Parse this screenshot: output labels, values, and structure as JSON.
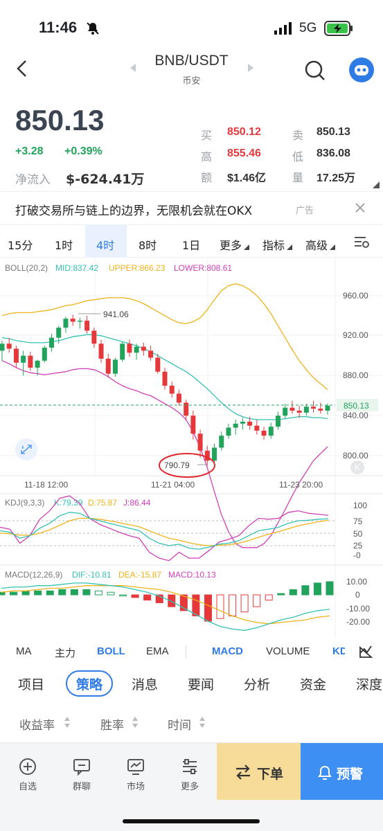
{
  "status": {
    "time": "11:46",
    "network": "5G"
  },
  "header": {
    "pair": "BNB/USDT",
    "exchange": "币安"
  },
  "price": {
    "last": "850.13",
    "change": "+3.28",
    "change_pct": "+0.39%",
    "net_inflow_label": "净流入",
    "net_inflow": "$-624.41万"
  },
  "quote": {
    "buy_label": "买",
    "buy": "850.12",
    "sell_label": "卖",
    "sell": "850.13",
    "high_label": "高",
    "high": "855.46",
    "low_label": "低",
    "low": "836.08",
    "amount_label": "额",
    "amount": "$1.46亿",
    "volume_label": "量",
    "volume": "17.25万"
  },
  "ad": {
    "text": "打破交易所与链上的边界，无限机会就在OKX",
    "tag": "广告"
  },
  "intervals": [
    "15分",
    "1时",
    "4时",
    "8时",
    "1日",
    "更多",
    "指标",
    "高级"
  ],
  "active_interval": "4时",
  "boll": {
    "label": "BOLL(20,2)",
    "mid": "MID:837.42",
    "upper": "UPPER:866.23",
    "lower": "LOWER:808.61"
  },
  "price_axis": [
    "960.00",
    "920.00",
    "880.00",
    "840.00",
    "800.00"
  ],
  "current_price_tag": "850.13",
  "annotations": {
    "high": "941.06",
    "low": "790.79"
  },
  "time_axis": [
    "11-18 12:00",
    "11-21 04:00",
    "11-23 20:00"
  ],
  "kdj": {
    "label": "KDJ(9,3,3)",
    "k": "K:79.39",
    "d": "D:75.87",
    "j": "J:86.44",
    "axis": [
      "100",
      "75",
      "50",
      "25",
      "-0"
    ]
  },
  "macd": {
    "label": "MACD(12,26,9)",
    "dif": "DIF:-10.81",
    "dea": "DEA:-15.87",
    "macd": "MACD:10.13",
    "axis": [
      "10.00",
      "0",
      "-10.00",
      "-20.00"
    ]
  },
  "indicator_tabs": [
    "MA",
    "主力",
    "BOLL",
    "EMA",
    "MACD",
    "VOLUME",
    "KD"
  ],
  "nav_tabs": [
    "项目",
    "策略",
    "消息",
    "要闻",
    "分析",
    "资金",
    "深度"
  ],
  "active_nav": "策略",
  "sort_options": [
    "收益率",
    "胜率",
    "时间"
  ],
  "bottom_nav": [
    "自选",
    "群聊",
    "市场",
    "更多"
  ],
  "actions": {
    "order": "下单",
    "alert": "预警"
  },
  "colors": {
    "up": "#21a35b",
    "down": "#e5383b",
    "accent": "#2f7be6",
    "upper": "#f1b21a",
    "mid": "#33c2b4",
    "lower": "#d13fb8"
  },
  "chart_data": {
    "type": "candlestick",
    "categories": [],
    "candles": [
      [
        905,
        915,
        895,
        912
      ],
      [
        912,
        918,
        903,
        907
      ],
      [
        907,
        910,
        888,
        893
      ],
      [
        893,
        905,
        880,
        900
      ],
      [
        900,
        904,
        885,
        888
      ],
      [
        888,
        896,
        880,
        895
      ],
      [
        895,
        910,
        893,
        908
      ],
      [
        908,
        922,
        904,
        918
      ],
      [
        918,
        930,
        912,
        928
      ],
      [
        928,
        939,
        923,
        937
      ],
      [
        937,
        941,
        930,
        934
      ],
      [
        934,
        938,
        927,
        935
      ],
      [
        935,
        940,
        922,
        925
      ],
      [
        925,
        928,
        908,
        912
      ],
      [
        912,
        916,
        893,
        897
      ],
      [
        897,
        902,
        878,
        882
      ],
      [
        882,
        898,
        879,
        896
      ],
      [
        896,
        914,
        894,
        912
      ],
      [
        912,
        916,
        899,
        903
      ],
      [
        903,
        912,
        896,
        909
      ],
      [
        909,
        913,
        900,
        905
      ],
      [
        905,
        910,
        895,
        898
      ],
      [
        898,
        902,
        882,
        884
      ],
      [
        884,
        888,
        866,
        870
      ],
      [
        870,
        874,
        858,
        862
      ],
      [
        862,
        866,
        850,
        853
      ],
      [
        853,
        856,
        836,
        840
      ],
      [
        840,
        845,
        816,
        822
      ],
      [
        822,
        826,
        798,
        805
      ],
      [
        805,
        810,
        790,
        795
      ],
      [
        795,
        812,
        792,
        808
      ],
      [
        808,
        824,
        805,
        820
      ],
      [
        820,
        832,
        817,
        828
      ],
      [
        828,
        836,
        821,
        832
      ],
      [
        832,
        838,
        826,
        834
      ],
      [
        834,
        839,
        826,
        830
      ],
      [
        830,
        836,
        821,
        825
      ],
      [
        825,
        829,
        816,
        820
      ],
      [
        820,
        833,
        817,
        829
      ],
      [
        829,
        844,
        826,
        840
      ],
      [
        840,
        852,
        837,
        848
      ],
      [
        848,
        855,
        842,
        845
      ],
      [
        845,
        850,
        838,
        843
      ],
      [
        843,
        852,
        840,
        849
      ],
      [
        849,
        855,
        843,
        847
      ],
      [
        847,
        853,
        842,
        845
      ],
      [
        845,
        852,
        841,
        850
      ]
    ],
    "boll_upper": [
      940,
      942,
      943,
      943,
      943,
      944,
      945,
      946,
      948,
      950,
      951,
      953,
      955,
      956,
      957,
      958,
      958,
      958,
      957,
      955,
      952,
      948,
      944,
      940,
      936,
      933,
      932,
      934,
      938,
      946,
      956,
      965,
      970,
      972,
      970,
      966,
      960,
      952,
      942,
      930,
      918,
      906,
      895,
      886,
      878,
      872,
      866
    ],
    "boll_mid": [
      918,
      917,
      915,
      914,
      913,
      913,
      913,
      914,
      915,
      917,
      919,
      920,
      921,
      921,
      920,
      918,
      916,
      914,
      912,
      910,
      907,
      904,
      900,
      896,
      892,
      888,
      884,
      879,
      873,
      867,
      860,
      853,
      847,
      842,
      839,
      837,
      836,
      836,
      836,
      836,
      837,
      838,
      839,
      839,
      838,
      838,
      837
    ],
    "boll_lower": [
      895,
      892,
      888,
      885,
      883,
      882,
      881,
      882,
      883,
      884,
      886,
      887,
      887,
      886,
      883,
      879,
      874,
      870,
      867,
      865,
      862,
      860,
      856,
      852,
      848,
      843,
      836,
      824,
      808,
      788,
      764,
      741,
      724,
      712,
      708,
      708,
      708,
      712,
      720,
      733,
      746,
      760,
      773,
      784,
      795,
      802,
      809
    ],
    "kdj_k": [
      55,
      52,
      40,
      45,
      60,
      70,
      85,
      92,
      90,
      80,
      75,
      70,
      65,
      60,
      55,
      40,
      30,
      25,
      28,
      20,
      18,
      22,
      28,
      30,
      35,
      45,
      55,
      58,
      62,
      70,
      75,
      76,
      78,
      79
    ],
    "kdj_d": [
      50,
      49,
      46,
      46,
      50,
      57,
      66,
      75,
      80,
      80,
      78,
      75,
      71,
      67,
      63,
      55,
      47,
      40,
      36,
      31,
      27,
      25,
      26,
      27,
      30,
      35,
      42,
      48,
      53,
      59,
      65,
      69,
      73,
      76
    ],
    "kdj_j": [
      62,
      58,
      30,
      45,
      78,
      95,
      120,
      125,
      110,
      80,
      68,
      60,
      52,
      45,
      40,
      12,
      0,
      -5,
      12,
      0,
      0,
      15,
      32,
      38,
      45,
      65,
      80,
      78,
      80,
      92,
      95,
      90,
      88,
      86
    ],
    "macd_dif": [
      5,
      6,
      6,
      7,
      7,
      8,
      9,
      9,
      8,
      7,
      6,
      4,
      2,
      -1,
      -5,
      -10,
      -15,
      -20,
      -24,
      -26,
      -27,
      -25,
      -22,
      -19,
      -17,
      -14,
      -12,
      -11
    ],
    "macd_dea": [
      2,
      3,
      3,
      4,
      5,
      5,
      6,
      7,
      7,
      7,
      7,
      6,
      5,
      4,
      2,
      -1,
      -4,
      -8,
      -12,
      -16,
      -19,
      -21,
      -22,
      -21,
      -20,
      -19,
      -17,
      -16
    ],
    "macd_hist": [
      2,
      2,
      3,
      3,
      3,
      4,
      4,
      4,
      3,
      2,
      0,
      -2,
      -4,
      -6,
      -9,
      -12,
      -16,
      -20,
      -18,
      -16,
      -13,
      -9,
      -4,
      1,
      4,
      7,
      9,
      10
    ]
  }
}
